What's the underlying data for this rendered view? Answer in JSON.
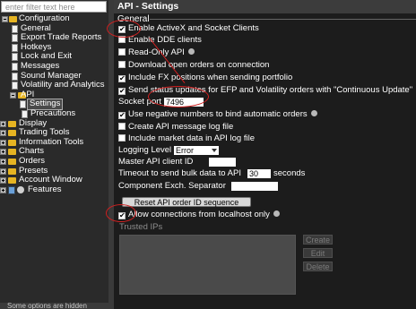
{
  "filter": {
    "placeholder": "enter filter text here"
  },
  "tree": {
    "items": [
      {
        "label": "Configuration",
        "icon": "folder-icon"
      },
      {
        "label": "General",
        "icon": "page-icon"
      },
      {
        "label": "Export Trade Reports",
        "icon": "page-icon"
      },
      {
        "label": "Hotkeys",
        "icon": "page-icon"
      },
      {
        "label": "Lock and Exit",
        "icon": "page-icon"
      },
      {
        "label": "Messages",
        "icon": "page-icon"
      },
      {
        "label": "Sound Manager",
        "icon": "page-icon"
      },
      {
        "label": "Volatility and Analytics",
        "icon": "page-icon"
      },
      {
        "label": "API",
        "icon": "folder-icon"
      },
      {
        "label": "Settings",
        "icon": "page-icon"
      },
      {
        "label": "Precautions",
        "icon": "page-icon"
      },
      {
        "label": "Display",
        "icon": "folder-icon"
      },
      {
        "label": "Trading Tools",
        "icon": "folder-icon"
      },
      {
        "label": "Information Tools",
        "icon": "folder-icon"
      },
      {
        "label": "Charts",
        "icon": "folder-icon"
      },
      {
        "label": "Orders",
        "icon": "folder-icon"
      },
      {
        "label": "Presets",
        "icon": "folder-icon"
      },
      {
        "label": "Account Window",
        "icon": "folder-icon"
      },
      {
        "label": "Features",
        "icon": "gear-icon"
      }
    ],
    "footer": "Some options are hidden"
  },
  "panel": {
    "title": "API - Settings",
    "section": "General",
    "options": {
      "enable_activex": {
        "label": "Enable ActiveX and Socket Clients",
        "checked": true
      },
      "enable_dde": {
        "label": "Enable DDE clients",
        "checked": false
      },
      "read_only": {
        "label": "Read-Only API",
        "checked": false
      },
      "download_orders": {
        "label": "Download open orders on connection",
        "checked": false
      },
      "include_fx": {
        "label": "Include FX positions when sending portfolio",
        "checked": true
      },
      "send_status": {
        "label": "Send status updates for EFP and Volatility orders with \"Continuous Update\"",
        "checked": true
      },
      "negative_numbers": {
        "label": "Use negative numbers to bind automatic orders",
        "checked": true
      },
      "create_log": {
        "label": "Create API message log file",
        "checked": false
      },
      "include_market": {
        "label": "Include market data in API log file",
        "checked": false
      },
      "allow_localhost": {
        "label": "Allow connections from localhost only",
        "checked": true
      }
    },
    "socket_port": {
      "label": "Socket port",
      "value": "7496"
    },
    "logging_level": {
      "label": "Logging Level",
      "value": "Error"
    },
    "master_client": {
      "label": "Master API client ID",
      "value": ""
    },
    "timeout": {
      "label": "Timeout to send bulk data to API",
      "value": "30",
      "unit": "seconds"
    },
    "component_sep": {
      "label": "Component Exch. Separator",
      "value": ""
    },
    "reset_button": "Reset API order ID sequence",
    "trusted_ips": {
      "label": "Trusted IPs"
    },
    "buttons": {
      "create": "Create",
      "edit": "Edit",
      "delete": "Delete"
    }
  },
  "colors": {
    "annotation": "#d02020",
    "folder": "#e6b422"
  }
}
